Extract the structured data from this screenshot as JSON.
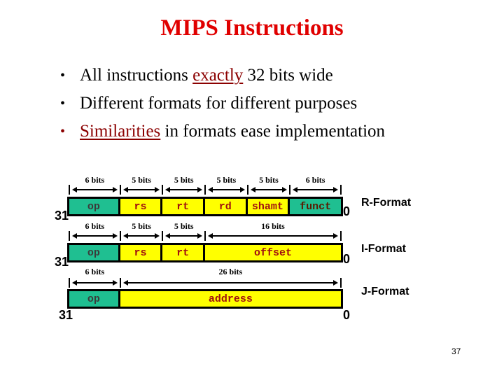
{
  "slide": {
    "title": "MIPS Instructions",
    "page_number": "37",
    "colors": {
      "title": "#e00000",
      "emphasis": "#8b0000",
      "field_teal": "#1fbf91",
      "field_yellow": "#ffff00",
      "field_text": "#a01010"
    }
  },
  "bullets": [
    {
      "before": "All instructions ",
      "emphasis": "exactly",
      "after": " 32 bits wide"
    },
    {
      "before": "Different formats for different purposes",
      "emphasis": "",
      "after": ""
    },
    {
      "before": "",
      "emphasis": "Similarities",
      "after": " in formats ease implementation"
    }
  ],
  "bullet_char": "•",
  "formats": [
    {
      "name": "R-Format",
      "high_bit": "31",
      "low_bit": "0",
      "fields": [
        {
          "label": "op",
          "bits": "6 bits",
          "color": "teal"
        },
        {
          "label": "rs",
          "bits": "5 bits",
          "color": "yellow"
        },
        {
          "label": "rt",
          "bits": "5 bits",
          "color": "yellow"
        },
        {
          "label": "rd",
          "bits": "5 bits",
          "color": "yellow"
        },
        {
          "label": "shamt",
          "bits": "5 bits",
          "color": "yellow"
        },
        {
          "label": "funct",
          "bits": "6 bits",
          "color": "teal"
        }
      ]
    },
    {
      "name": "I-Format",
      "high_bit": "31",
      "low_bit": "0",
      "fields": [
        {
          "label": "op",
          "bits": "6 bits",
          "color": "teal"
        },
        {
          "label": "rs",
          "bits": "5 bits",
          "color": "yellow"
        },
        {
          "label": "rt",
          "bits": "5 bits",
          "color": "yellow"
        },
        {
          "label": "offset",
          "bits": "16 bits",
          "color": "yellow"
        }
      ]
    },
    {
      "name": "J-Format",
      "high_bit": "31",
      "low_bit": "0",
      "fields": [
        {
          "label": "op",
          "bits": "6 bits",
          "color": "teal"
        },
        {
          "label": "address",
          "bits": "26 bits",
          "color": "yellow"
        }
      ]
    }
  ]
}
